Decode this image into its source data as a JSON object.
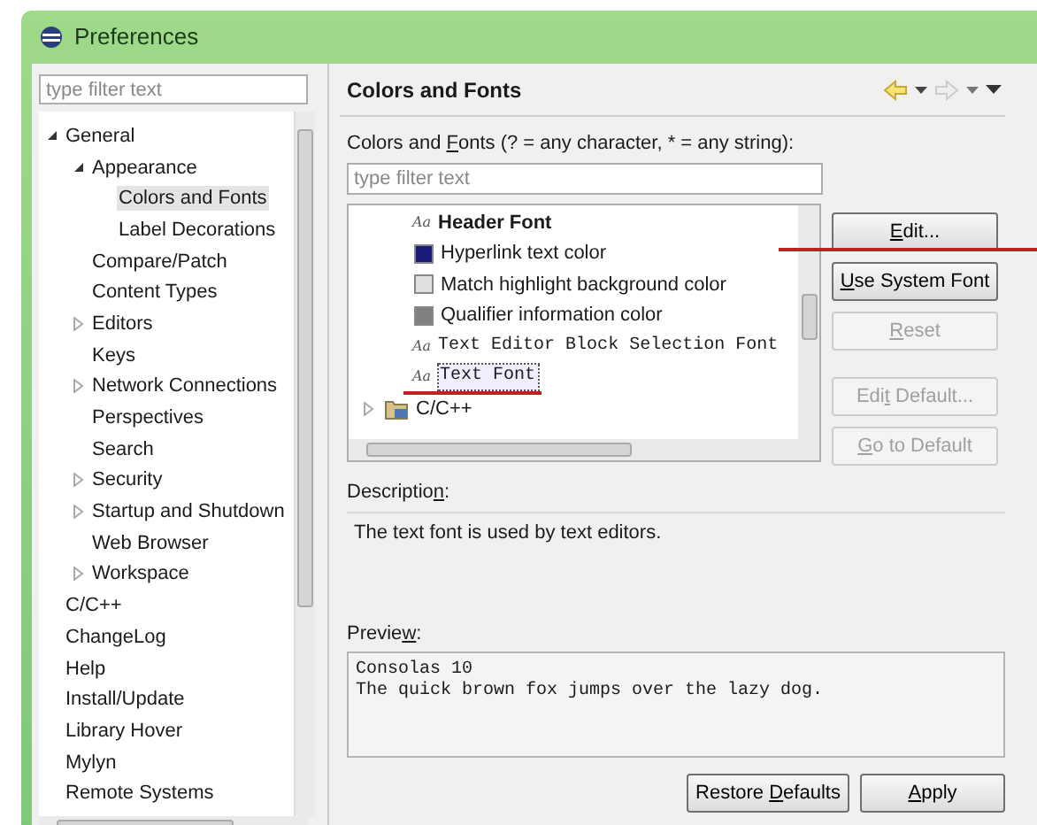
{
  "window": {
    "title": "Preferences"
  },
  "sidebar": {
    "filter": {
      "placeholder": "type filter text"
    },
    "items": [
      {
        "label": "General",
        "selected": false,
        "expanded": true,
        "children": [
          {
            "label": "Appearance",
            "selected": false,
            "expanded": true,
            "children": [
              {
                "label": "Colors and Fonts",
                "selected": true
              },
              {
                "label": "Label Decorations",
                "selected": false
              }
            ]
          },
          {
            "label": "Compare/Patch",
            "selected": false
          },
          {
            "label": "Content Types",
            "selected": false
          },
          {
            "label": "Editors",
            "selected": false,
            "expanded": false
          },
          {
            "label": "Keys",
            "selected": false
          },
          {
            "label": "Network Connections",
            "selected": false,
            "expanded": false
          },
          {
            "label": "Perspectives",
            "selected": false
          },
          {
            "label": "Search",
            "selected": false
          },
          {
            "label": "Security",
            "selected": false,
            "expanded": false
          },
          {
            "label": "Startup and Shutdown",
            "selected": false,
            "expanded": false
          },
          {
            "label": "Web Browser",
            "selected": false
          },
          {
            "label": "Workspace",
            "selected": false,
            "expanded": false
          }
        ]
      },
      {
        "label": "C/C++",
        "selected": false
      },
      {
        "label": "ChangeLog",
        "selected": false
      },
      {
        "label": "Help",
        "selected": false
      },
      {
        "label": "Install/Update",
        "selected": false
      },
      {
        "label": "Library Hover",
        "selected": false
      },
      {
        "label": "Mylyn",
        "selected": false
      },
      {
        "label": "Remote Systems",
        "selected": false
      }
    ]
  },
  "page": {
    "title": "Colors and Fonts",
    "filter_label": "Colors and **F**onts (? = any character, * = any string):",
    "filter": {
      "placeholder": "type filter text"
    },
    "entries": [
      {
        "kind": "bold_font",
        "icon_text": "Aa",
        "label": "Header Font",
        "selected": false
      },
      {
        "kind": "color",
        "label": "Hyperlink text color",
        "color": "#1a1a7a",
        "selected": false
      },
      {
        "kind": "color",
        "label": "Match highlight background color",
        "color": "#e0e0e0",
        "selected": false
      },
      {
        "kind": "color",
        "label": "Qualifier information color",
        "color": "#808080",
        "selected": false
      },
      {
        "kind": "mono_font",
        "icon_text": "Aa",
        "label": "Text Editor Block Selection Font",
        "selected": false
      },
      {
        "kind": "mono_font",
        "icon_text": "Aa",
        "label": "Text Font",
        "selected": true
      },
      {
        "kind": "category",
        "label": "C/C++",
        "selected": false
      }
    ],
    "buttons": [
      {
        "label": "**E**dit...",
        "disabled": false
      },
      {
        "label": "**U**se System Font",
        "disabled": false
      },
      {
        "label": "**R**eset",
        "disabled": true
      },
      {
        "label": "Edi**t** Default...",
        "disabled": true
      },
      {
        "label": "**G**o to Default",
        "disabled": true
      }
    ],
    "description_label": "Descriptio**n**:",
    "description": "The text font is used by text editors.",
    "preview_label": "Previe**w**:",
    "preview": [
      "Consolas 10",
      "The quick brown fox jumps over the lazy dog."
    ],
    "footer_buttons": [
      "Restore **D**efaults",
      "**A**pply"
    ]
  }
}
